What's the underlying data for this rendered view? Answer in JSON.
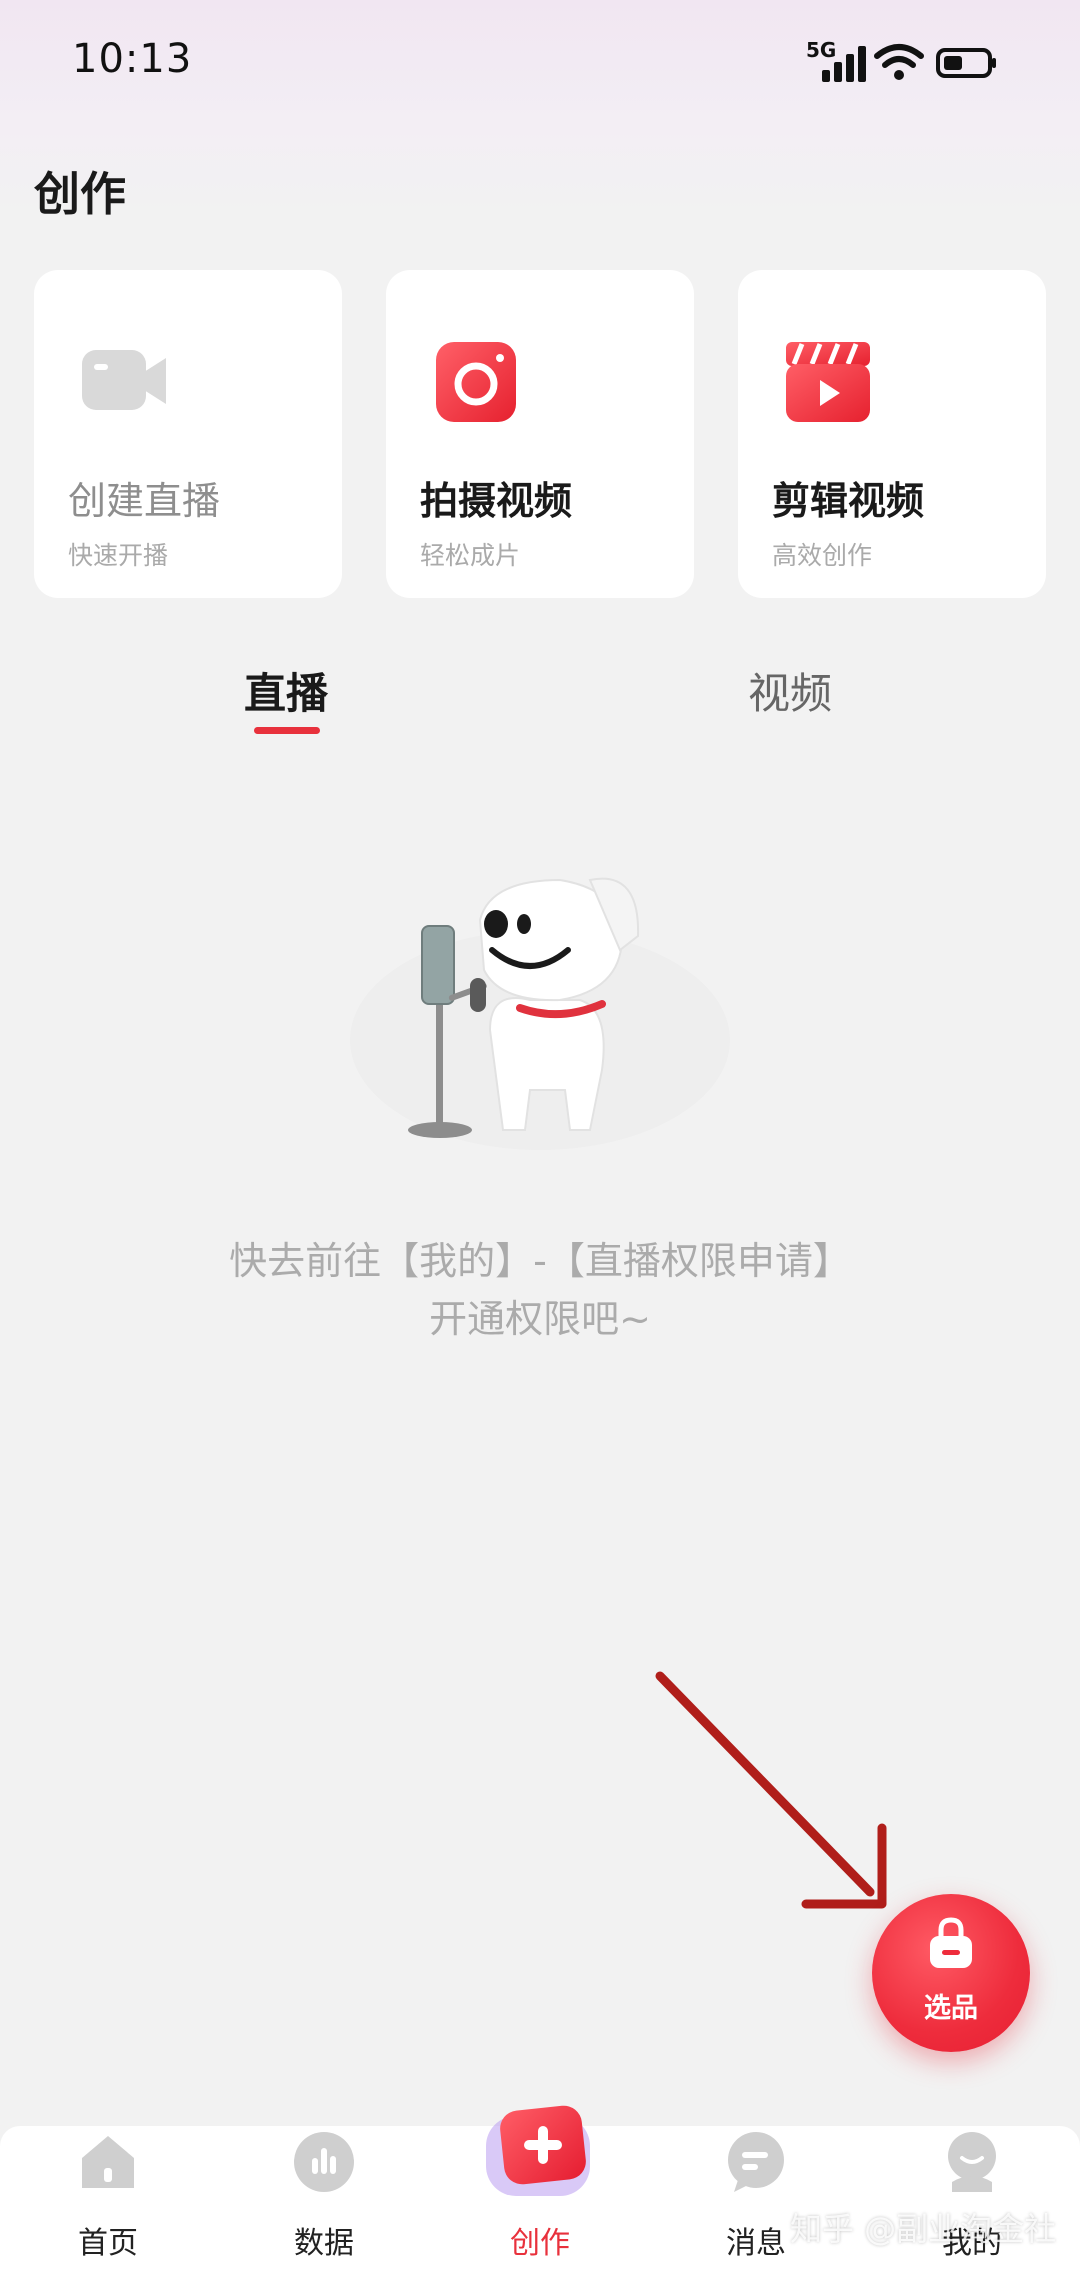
{
  "status_bar": {
    "time": "10:13",
    "network": "5G"
  },
  "page_title": "创作",
  "cards": [
    {
      "title": "创建直播",
      "subtitle": "快速开播",
      "icon": "video-camera-icon",
      "enabled": false
    },
    {
      "title": "拍摄视频",
      "subtitle": "轻松成片",
      "icon": "camera-icon",
      "enabled": true
    },
    {
      "title": "剪辑视频",
      "subtitle": "高效创作",
      "icon": "clapperboard-icon",
      "enabled": true
    }
  ],
  "tabs": {
    "items": [
      "直播",
      "视频"
    ],
    "active": "直播"
  },
  "empty_state": {
    "line1": "快去前往【我的】-【直播权限申请】",
    "line2": "开通权限吧~"
  },
  "fab": {
    "label": "选品",
    "icon": "shopping-bag-icon"
  },
  "bottom_nav": [
    {
      "label": "首页",
      "icon": "home-icon",
      "active": false
    },
    {
      "label": "数据",
      "icon": "bar-chart-icon",
      "active": false
    },
    {
      "label": "创作",
      "icon": "plus-icon",
      "active": true
    },
    {
      "label": "消息",
      "icon": "message-icon",
      "active": false
    },
    {
      "label": "我的",
      "icon": "profile-icon",
      "active": false
    }
  ],
  "watermark": "知乎 @副业淘金社",
  "colors": {
    "accent": "#e8313c",
    "background": "#f2f2f2",
    "muted_text": "#ababab",
    "arrow": "#b01e1a"
  }
}
